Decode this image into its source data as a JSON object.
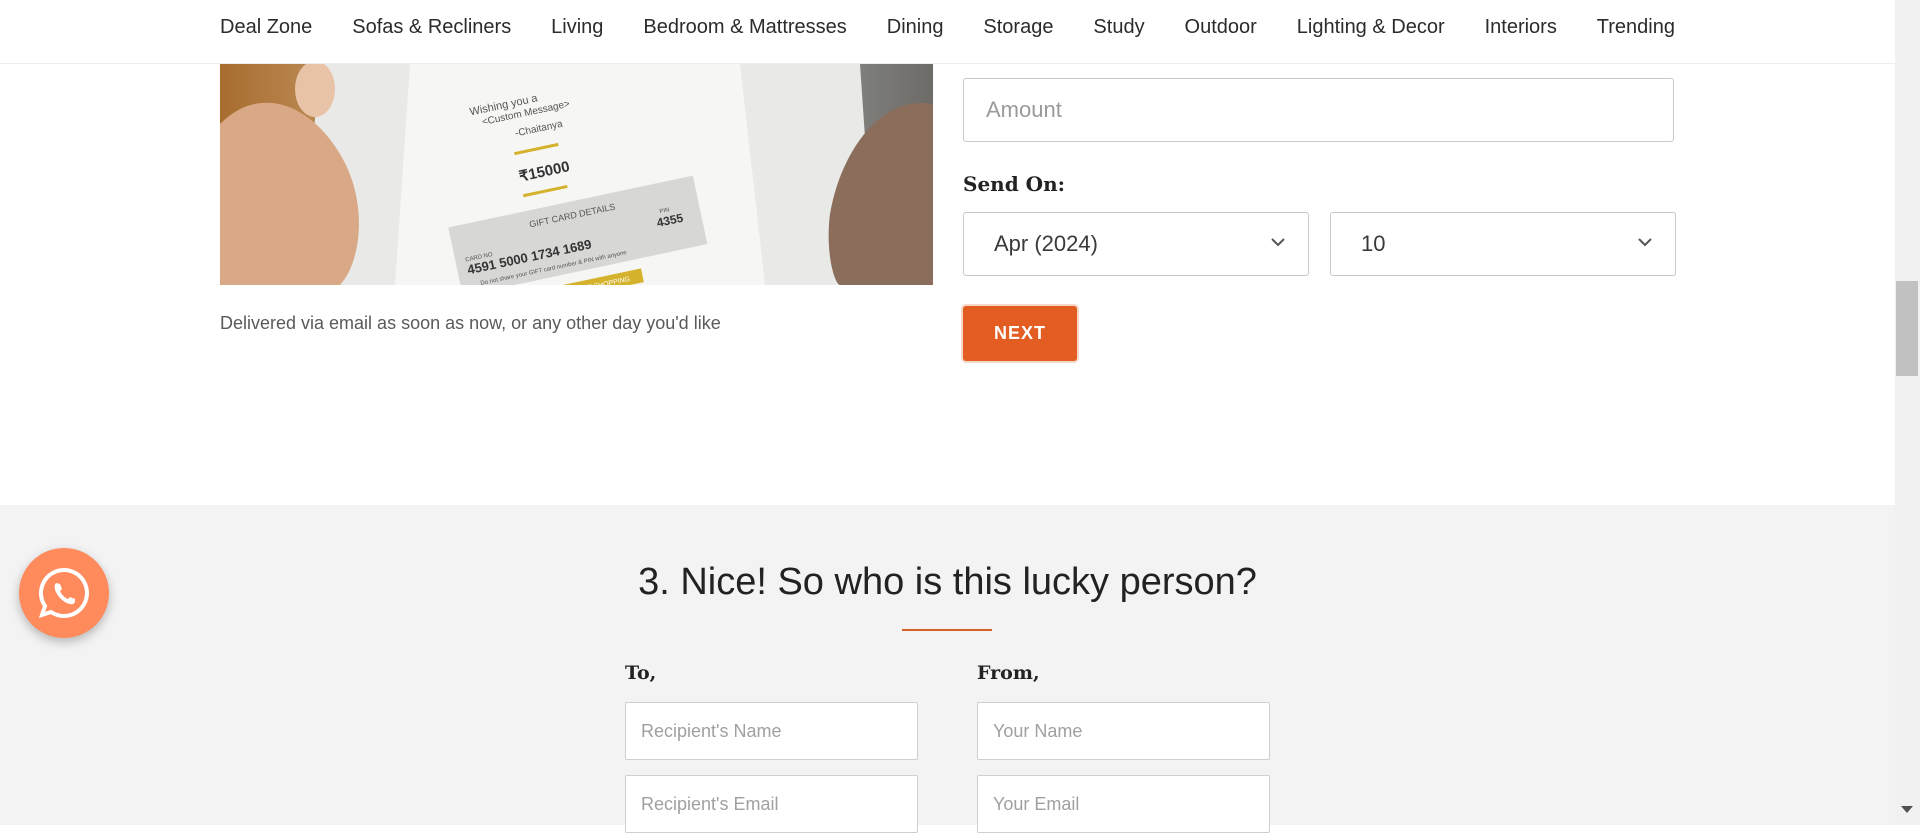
{
  "nav": {
    "items": [
      {
        "label": "Deal Zone"
      },
      {
        "label": "Sofas & Recliners"
      },
      {
        "label": "Living"
      },
      {
        "label": "Bedroom & Mattresses"
      },
      {
        "label": "Dining"
      },
      {
        "label": "Storage"
      },
      {
        "label": "Study"
      },
      {
        "label": "Outdoor"
      },
      {
        "label": "Lighting & Decor"
      },
      {
        "label": "Interiors"
      },
      {
        "label": "Trending"
      }
    ]
  },
  "gift_card": {
    "message_line1": "Wishing you a",
    "message_line2": "<Custom Message>",
    "signature": "-Chaitanya",
    "amount": "₹15000",
    "details_title": "GIFT CARD DETAILS",
    "card_no_label": "CARD NO",
    "card_no": "4591 5000 1734 1689",
    "pin_label": "PIN",
    "pin": "4355",
    "warning": "Do not share your GIFT card number & PIN with anyone",
    "cta": "START SHOPPING",
    "delivered_note": "Delivered via email as soon as now, or any other day you'd like"
  },
  "form": {
    "amount_placeholder": "Amount",
    "send_on_label": "Send On:",
    "month_value": "Apr (2024)",
    "day_value": "10",
    "next_label": "NEXT"
  },
  "section3": {
    "title": "3. Nice! So who is this lucky person?",
    "to_label": "To,",
    "from_label": "From,",
    "recipient_name_placeholder": "Recipient's Name",
    "recipient_email_placeholder": "Recipient's Email",
    "your_name_placeholder": "Your Name",
    "your_email_placeholder": "Your Email"
  },
  "colors": {
    "accent": "#e35d22",
    "whatsapp_bg": "#ff8a5c",
    "section_bg": "#f3f3f3"
  },
  "icons": [
    "whatsapp-icon",
    "chevron-down-icon",
    "scroll-down-arrow-icon"
  ]
}
